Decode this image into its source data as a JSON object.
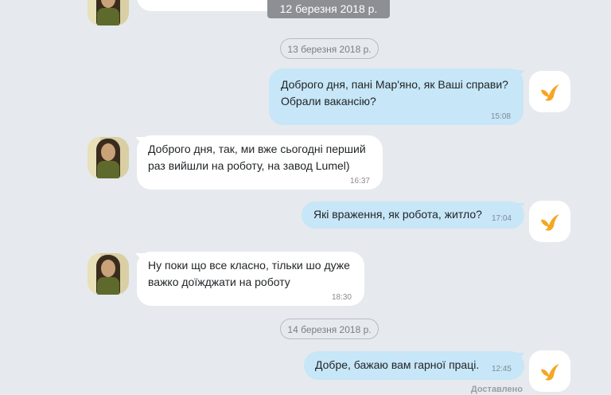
{
  "top_date": "12 березня 2018 р.",
  "messages": [
    {
      "date_separator": "13 березня 2018 р."
    },
    {
      "direction": "out",
      "text_line1": "Доброго дня, пані Мар'яно, як Ваші справи?",
      "text_line2": "Обрали вакансію?",
      "time": "15:08"
    },
    {
      "direction": "in",
      "text_line1": "Доброго дня, так, ми вже сьогодні перший",
      "text_line2": "раз вийшли на роботу, на завод Lumel)",
      "time": "16:37"
    },
    {
      "direction": "out",
      "text_line1": "Які враження, як робота, житло?",
      "time": "17:04"
    },
    {
      "direction": "in",
      "text_line1": "Ну поки що все класно, тільки шо дуже",
      "text_line2": "важко доїжджати на роботу",
      "time": "18:30"
    },
    {
      "date_separator": "14 березня 2018 р."
    },
    {
      "direction": "out",
      "text_line1": "Добре, бажаю вам гарної праці.",
      "time": "12:45"
    }
  ],
  "delivery_status": "Доставлено",
  "colors": {
    "background": "#e6e9ed",
    "outgoing_bubble": "#c7e6f7",
    "incoming_bubble": "#ffffff",
    "bot_logo": "#f5a623"
  },
  "icons": {
    "bot_avatar": "bird-logo-icon",
    "contact_avatar": "user-photo"
  }
}
